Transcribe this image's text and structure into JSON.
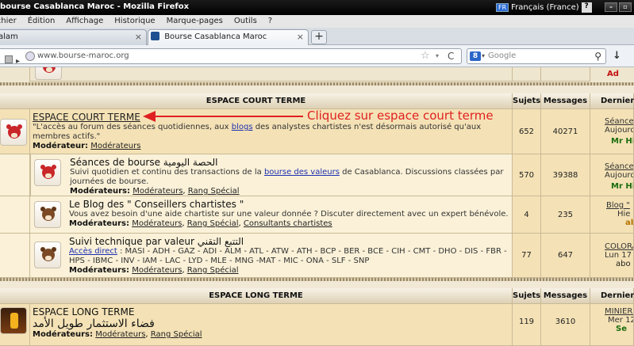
{
  "window": {
    "title": "bourse Casablanca Maroc - Mozilla Firefox",
    "language_flag": "FR",
    "language_label": "Français (France)",
    "help": "?"
  },
  "menu": [
    "Fichier",
    "Édition",
    "Affichage",
    "Historique",
    "Marque-pages",
    "Outils",
    "?"
  ],
  "tabs": [
    {
      "label": "alam",
      "active": false
    },
    {
      "label": "Bourse Casablanca Maroc",
      "active": true
    }
  ],
  "address_bar": {
    "url": "www.bourse-maroc.org"
  },
  "search": {
    "engine": "8",
    "placeholder": "Google"
  },
  "annotation": "Cliquez sur espace court terme",
  "sections": [
    {
      "header": "ESPACE COURT TERME",
      "col_topics": "Sujets",
      "col_messages": "Messages",
      "col_last": "Derniers",
      "forums": [
        {
          "icon": "bull-icon",
          "title": "ESPACE COURT TERME",
          "desc_before": "\"L'accès au forum des séances quotidiennes, aux ",
          "desc_link": "blogs",
          "desc_after": " des analystes chartistes n'est désormais autorisé qu'aux membres actifs.\"",
          "mod_label": "Modérateur:",
          "mods": [
            "Modérateurs"
          ],
          "topics": "652",
          "messages": "40271",
          "last": [
            "Séance",
            "Aujourd",
            "Mr Hi"
          ]
        },
        {
          "icon": "bull-icon",
          "title": "Séances de bourse الحصة اليومية",
          "desc_before": "Suivi quotidien et continu des transactions de la ",
          "desc_link": "bourse des valeurs",
          "desc_after": " de Casablanca. Discussions classées par journées de bourse.",
          "mod_label": "Modérateurs:",
          "mods": [
            "Modérateurs",
            "Rang Spécial"
          ],
          "topics": "570",
          "messages": "39388",
          "last": [
            "Séance",
            "Aujourd",
            "Mr Hi"
          ]
        },
        {
          "icon": "bear-icon",
          "title": "Le Blog des \" Conseillers chartistes \"",
          "desc_before": "Vous avez besoin d'une aide chartiste sur une valeur donnée ? Discuter directement avec un expert bénévole.",
          "desc_link": "",
          "desc_after": "",
          "mod_label": "Modérateurs:",
          "mods": [
            "Modérateurs",
            "Rang Spécial",
            "Consultants chartistes"
          ],
          "topics": "4",
          "messages": "235",
          "last": [
            "Blog \"",
            "Hie",
            "ab"
          ]
        },
        {
          "icon": "bear-icon",
          "title": "Suivi technique par valeur التتبع التقني",
          "desc_before": "",
          "desc_link": "Accès direct",
          "desc_after": " : MASI - ADH - GAZ - ADI - ALM - ATL - ATW - ATH - BCP - BER - BCE - CIH - CMT - DHO - DIS - FBR - HPS - IBMC - INV - IAM - LAC - LYD - MLE - MNG -MAT - MIC - ONA - SLF - SNP",
          "mod_label": "Modérateurs:",
          "mods": [
            "Modérateurs",
            "Rang Spécial"
          ],
          "topics": "77",
          "messages": "647",
          "last": [
            "COLORA",
            "Lun 17",
            "abo"
          ]
        }
      ]
    },
    {
      "header": "ESPACE LONG TERME",
      "col_topics": "Sujets",
      "col_messages": "Messages",
      "col_last": "Dernier",
      "forums": [
        {
          "icon": "lantern-icon",
          "title": "ESPACE LONG TERME",
          "title_ar": "فضاء الاستثمار طويل الأمد",
          "mod_label": "Modérateurs:",
          "mods": [
            "Modérateurs",
            "Rang Spécial"
          ],
          "topics": "119",
          "messages": "3610",
          "last": [
            "MINIERE",
            "Mer 12",
            "Se"
          ]
        }
      ]
    }
  ],
  "top_partial_row": {
    "last": [
      "",
      "Ad"
    ]
  },
  "colors": {
    "accent_red": "#e02020",
    "link_blue": "#1c2fb0",
    "green_user": "#1b6d0f"
  }
}
